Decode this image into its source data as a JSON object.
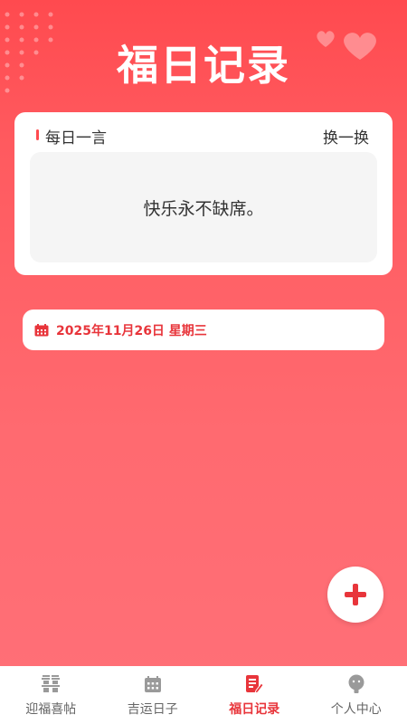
{
  "header": {
    "title": "福日记录"
  },
  "quote": {
    "label": "每日一言",
    "refresh_label": "换一换",
    "text": "快乐永不缺席。"
  },
  "date": {
    "text": "2025年11月26日 星期三"
  },
  "fab": {
    "icon": "plus-icon"
  },
  "tabs": [
    {
      "label": "迎福喜帖",
      "icon": "double-happiness-icon",
      "active": false
    },
    {
      "label": "吉运日子",
      "icon": "calendar-icon",
      "active": false
    },
    {
      "label": "福日记录",
      "icon": "notes-edit-icon",
      "active": true
    },
    {
      "label": "个人中心",
      "icon": "profile-icon",
      "active": false
    }
  ],
  "colors": {
    "accent": "#e8353b",
    "background_top": "#ff4a4f",
    "background_bottom": "#ff7078",
    "inactive_tab": "#999999"
  }
}
